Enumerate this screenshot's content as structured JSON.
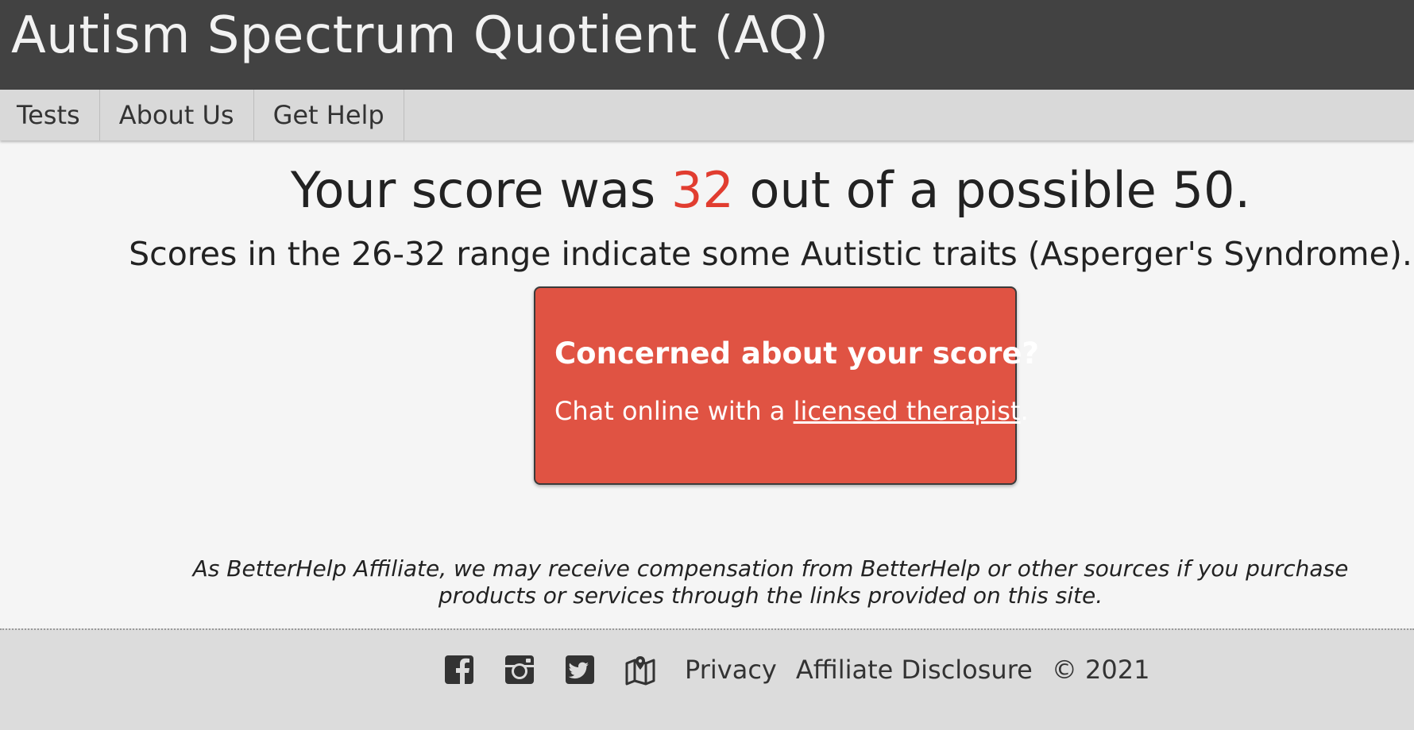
{
  "header": {
    "title": "Autism Spectrum Quotient (AQ)"
  },
  "nav": {
    "items": [
      {
        "label": "Tests"
      },
      {
        "label": "About Us"
      },
      {
        "label": "Get Help"
      }
    ]
  },
  "result": {
    "prefix": "Your score was ",
    "score": "32",
    "suffix": " out of a possible 50.",
    "interpretation": "Scores in the 26-32 range indicate some Autistic traits (Asperger's Syndrome)."
  },
  "cta": {
    "title": "Concerned about your score?",
    "text_before": "Chat online with a ",
    "link": "licensed therapist",
    "text_after": "."
  },
  "disclaimer": "As BetterHelp Affiliate, we may receive compensation from BetterHelp or other sources if you purchase products or services through the links provided on this site.",
  "footer": {
    "icons": [
      "facebook-icon",
      "instagram-icon",
      "twitter-icon",
      "map-icon"
    ],
    "privacy": "Privacy",
    "affiliate": "Affiliate Disclosure",
    "copyright": "© 2021"
  },
  "colors": {
    "header_bg": "#424242",
    "accent_red": "#e05343",
    "score_red": "#e13d30"
  }
}
